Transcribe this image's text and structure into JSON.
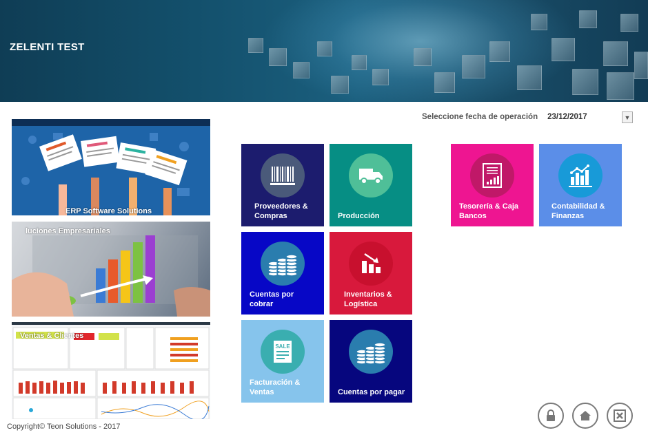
{
  "app": {
    "title": "ZELENTI TEST"
  },
  "date_selector": {
    "label": "Seleccione fecha de operación",
    "value": "23/12/2017"
  },
  "banners": [
    {
      "caption": "ERP Software Solutions"
    },
    {
      "caption": "luciones Empresariales"
    },
    {
      "caption": "Ventas & Clientes"
    }
  ],
  "tiles": {
    "proveedores": {
      "label": "Proveedores & Compras",
      "color": "#1c1c6e",
      "icon": "barcode-icon"
    },
    "produccion": {
      "label": "Producción",
      "color": "#068e84",
      "icon": "truck-icon"
    },
    "cuentas_cobrar": {
      "label": "Cuentas por cobrar",
      "color": "#0707c6",
      "icon": "coins-icon"
    },
    "inventarios": {
      "label": "Inventarios & Logística",
      "color": "#d8193c",
      "icon": "bar-chart-down-icon"
    },
    "facturacion": {
      "label": "Facturación & Ventas",
      "color": "#86c4ec",
      "icon": "sale-receipt-icon"
    },
    "cuentas_pagar": {
      "label": "Cuentas por pagar",
      "color": "#06067e",
      "icon": "coins-icon"
    },
    "tesoreria": {
      "label": "Tesorería & Caja Bancos",
      "color": "#ee1591",
      "icon": "report-icon"
    },
    "contabilidad": {
      "label": "Contabilidad & Finanzas",
      "color": "#5b8ee8",
      "icon": "bar-chart-up-icon"
    }
  },
  "footer": {
    "copyright": "Copyright© Teon Solutions - 2017"
  },
  "buttons": {
    "lock": "lock-icon",
    "home": "home-icon",
    "close": "close-icon"
  }
}
